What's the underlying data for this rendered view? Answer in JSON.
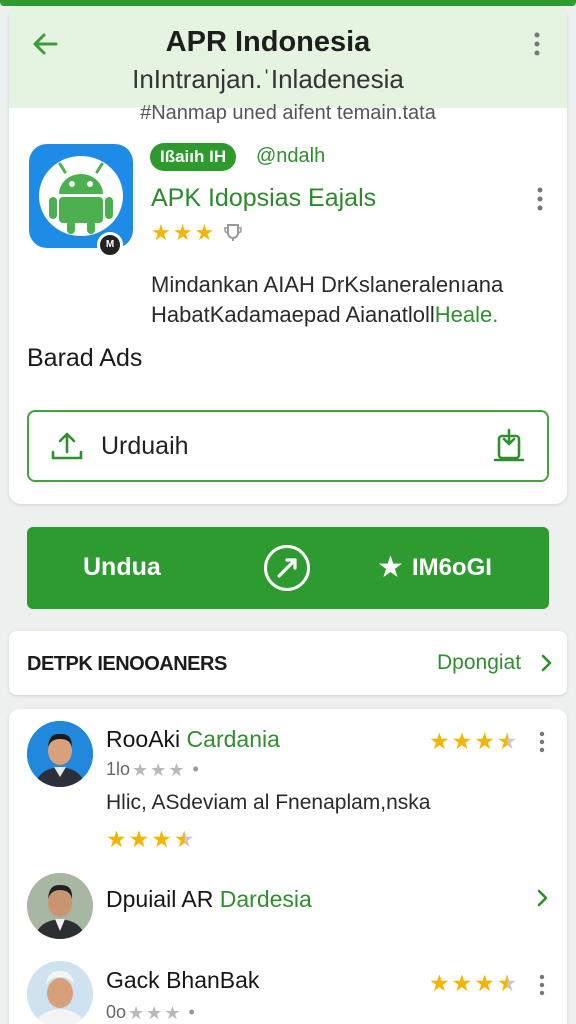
{
  "header": {
    "title": "APR Indonesia",
    "subtitle": "InIntranjan.ˈInladenesia",
    "tagline": "#Nanmap uned aifent temain.tata"
  },
  "app": {
    "badge_label": "Ißaiıh IH",
    "handle": "@ndalh",
    "name": "APK Idopsias Eajals",
    "rating_stars_filled": 3,
    "description_line1": "Mindankan AIAH DrKslaneralenıana",
    "description_line2_prefix": "HabatKadamaepad Aianatloll",
    "description_line2_highlight": "Heale.",
    "icon_badge": "M"
  },
  "ads_label": "Barad Ads",
  "download": {
    "label": "Urduaih"
  },
  "actions": {
    "primary_label": "Undua",
    "favorite_label": "IM6oGI"
  },
  "section": {
    "title": "DETPK IENOOANERS",
    "more_label": "Dpongiat"
  },
  "reviews": [
    {
      "name": "RooAki",
      "name_accent": "Cardania",
      "meta_prefix": "1lo",
      "meta_rating": 3,
      "rating": 3.5,
      "text": "Hlic, ASdeviam al Fnenaplam,nska",
      "inline_rating": 3.5
    },
    {
      "name": "Dpuiail AR",
      "name_accent": "Dardesia"
    },
    {
      "name": "Gack BhanBak",
      "meta_prefix": "0o",
      "meta_rating": 3,
      "rating": 3.5
    }
  ],
  "colors": {
    "brand_green": "#2e9b31",
    "header_tint": "#e4f4e1",
    "star": "#f2b600",
    "app_icon_blue": "#1e8be6"
  },
  "icons": [
    "back-arrow-icon",
    "more-vert-icon",
    "android-icon",
    "download-icon",
    "share-icon",
    "star-icon",
    "chevron-right-icon"
  ]
}
